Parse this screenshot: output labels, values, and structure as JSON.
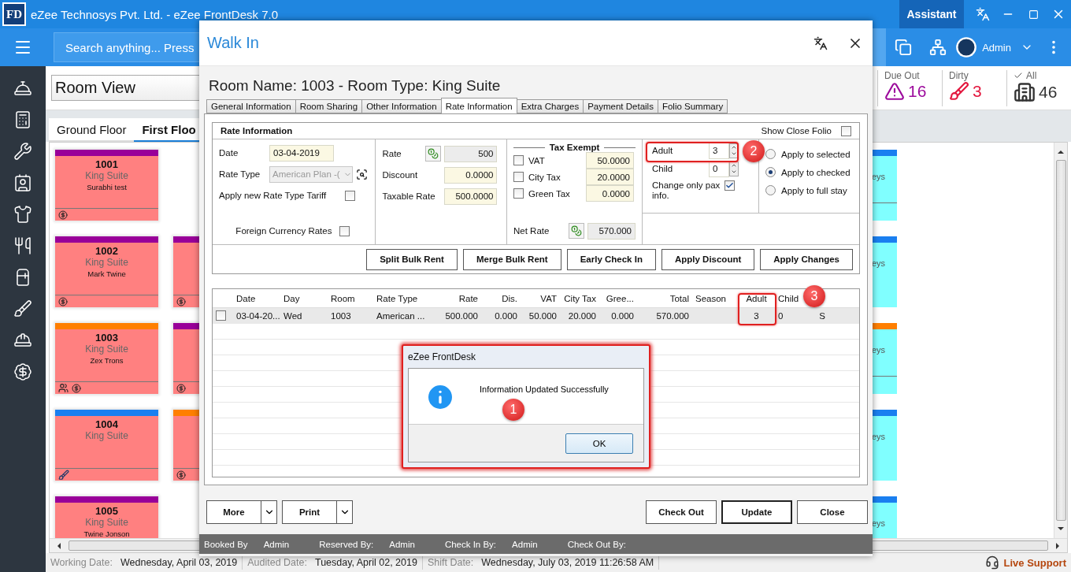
{
  "app": {
    "logo": "FD",
    "title": "eZee Technosys Pvt. Ltd. - eZee FrontDesk 7.0",
    "assistant": "Assistant",
    "search_placeholder": "Search anything... Press",
    "user": "Admin"
  },
  "room_view": {
    "view": "Room View",
    "floor_tabs": [
      {
        "label": "Ground Floor",
        "selected": false
      },
      {
        "label": "First Floo",
        "selected": true
      }
    ],
    "stats": [
      {
        "kind": "due_out",
        "label": "Due Out",
        "value": "16",
        "color": "#9c0a9c"
      },
      {
        "kind": "dirty",
        "label": "Dirty",
        "value": "3",
        "color": "#e3173e"
      },
      {
        "kind": "all",
        "label": "All",
        "value": "46",
        "color": "#333333"
      }
    ],
    "room_columns": [
      [
        {
          "number": "1001",
          "type": "King Suite",
          "guest": "Surabhi test",
          "color": "#990099",
          "payment": true,
          "group": false,
          "cleaning": false
        },
        {
          "number": "1002",
          "type": "King Suite",
          "guest": "Mark Twine",
          "color": "#990099",
          "payment": true,
          "group": false,
          "cleaning": false
        },
        {
          "number": "1003",
          "type": "King Suite",
          "guest": "Zex Trons",
          "color": "#ff7f00",
          "payment": true,
          "group": true,
          "cleaning": false
        },
        {
          "number": "1004",
          "type": "King Suite",
          "color": "#1a7ff0",
          "payment": false,
          "group": false,
          "cleaning": true
        },
        {
          "number": "1005",
          "type": "King Suite",
          "guest": "Twine Jonson",
          "color": "#990099"
        }
      ],
      [
        null,
        {
          "color": "#990099",
          "payment": true,
          "group": false,
          "cleaning": false
        },
        {
          "color": "#990099",
          "payment": true,
          "group": false,
          "cleaning": false
        },
        {
          "color": "#ff7f00",
          "payment": true,
          "group": false,
          "cleaning": false
        }
      ]
    ],
    "edge_cards": [
      {
        "color": "#1a7ff0",
        "text": "eys",
        "divider": true
      },
      {
        "color": "#1a7ff0",
        "text": "eys",
        "divider": false
      },
      {
        "color": "#ff7f00",
        "text": "eys",
        "divider": true
      },
      {
        "color": "#1a7ff0",
        "text": "eys",
        "divider": false
      },
      {
        "color": "#1a7ff0",
        "text": "eys"
      }
    ]
  },
  "status_bar": [
    {
      "label": "Working Date:",
      "value": "Wednesday, April 03, 2019"
    },
    {
      "label": "Audited Date:",
      "value": "Tuesday, April 02, 2019"
    },
    {
      "label": "Shift Date:",
      "value": "Wednesday, July 03, 2019 11:26:58 AM"
    }
  ],
  "live_support": "Live Support",
  "dialog": {
    "title": "Walk In",
    "heading": "Room Name: 1003 - Room Type: King Suite",
    "tabs": [
      {
        "label": "General Information",
        "selected": false
      },
      {
        "label": "Room Sharing",
        "selected": false
      },
      {
        "label": "Other Information",
        "selected": false
      },
      {
        "label": "Rate Information",
        "selected": true
      },
      {
        "label": "Extra Charges",
        "selected": false
      },
      {
        "label": "Payment Details",
        "selected": false
      },
      {
        "label": "Folio Summary",
        "selected": false
      }
    ],
    "rate_info": {
      "title": "Rate Information",
      "show_close_folio": {
        "label": "Show Close Folio",
        "checked": false
      },
      "date": {
        "label": "Date",
        "value": "03-04-2019"
      },
      "rate_type": {
        "label": "Rate Type",
        "value": "American Plan -(",
        "disabled": true
      },
      "apply_new_tariff": {
        "label": "Apply new Rate Type Tariff",
        "checked": false
      },
      "foreign_currency": {
        "label": "Foreign Currency Rates",
        "checked": false
      },
      "amounts": [
        {
          "label": "Rate",
          "value": "500",
          "readonly": true
        },
        {
          "label": "Discount",
          "value": "0.0000",
          "readonly": false
        },
        {
          "label": "Taxable Rate",
          "value": "500.0000",
          "readonly": false
        }
      ],
      "tax_exempt": {
        "title": "Tax Exempt",
        "taxes": [
          {
            "label": "VAT",
            "value": "50.0000",
            "checked": false
          },
          {
            "label": "City Tax",
            "value": "20.0000",
            "checked": false
          },
          {
            "label": "Green Tax",
            "value": "0.0000",
            "checked": false
          }
        ],
        "net_rate": {
          "label": "Net Rate",
          "value": "570.000"
        }
      },
      "pax": [
        {
          "label": "Adult",
          "value": "3"
        },
        {
          "label": "Child",
          "value": "0"
        }
      ],
      "pax_only": {
        "label": "Change only pax info.",
        "checked": true
      },
      "apply_options": [
        {
          "label": "Apply to selected",
          "selected": false
        },
        {
          "label": "Apply to checked",
          "selected": true
        },
        {
          "label": "Apply to full stay",
          "selected": false
        }
      ],
      "actions": [
        "Split Bulk Rent",
        "Merge Bulk Rent",
        "Early Check In",
        "Apply Discount",
        "Apply Changes"
      ]
    },
    "grid": {
      "columns": [
        "Date",
        "Day",
        "Room",
        "Rate Type",
        "Rate",
        "Dis.",
        "VAT",
        "City Tax",
        "Gree...",
        "Total",
        "Season",
        "Adult",
        "Child"
      ],
      "rows": [
        {
          "checked": false,
          "cells": [
            "03-04-20...",
            "Wed",
            "1003",
            "American ...",
            "500.000",
            "0.000",
            "50.000",
            "20.000",
            "0.000",
            "570.000",
            null,
            "3",
            "0",
            "S"
          ]
        }
      ]
    },
    "left_buttons": [
      "More",
      "Print"
    ],
    "right_buttons": [
      {
        "label": "Check Out",
        "default": false
      },
      {
        "label": "Update",
        "default": true
      },
      {
        "label": "Close",
        "default": false
      }
    ],
    "audit": [
      {
        "label": "Booked By",
        "value": "Admin"
      },
      {
        "label": "Reserved By:",
        "value": "Admin"
      },
      {
        "label": "Check In By:",
        "value": "Admin"
      },
      {
        "label": "Check Out By:"
      }
    ]
  },
  "message_box": {
    "title": "eZee FrontDesk",
    "message": "Information Updated Successfully",
    "button": "OK"
  },
  "callouts": [
    "1",
    "2",
    "3"
  ]
}
